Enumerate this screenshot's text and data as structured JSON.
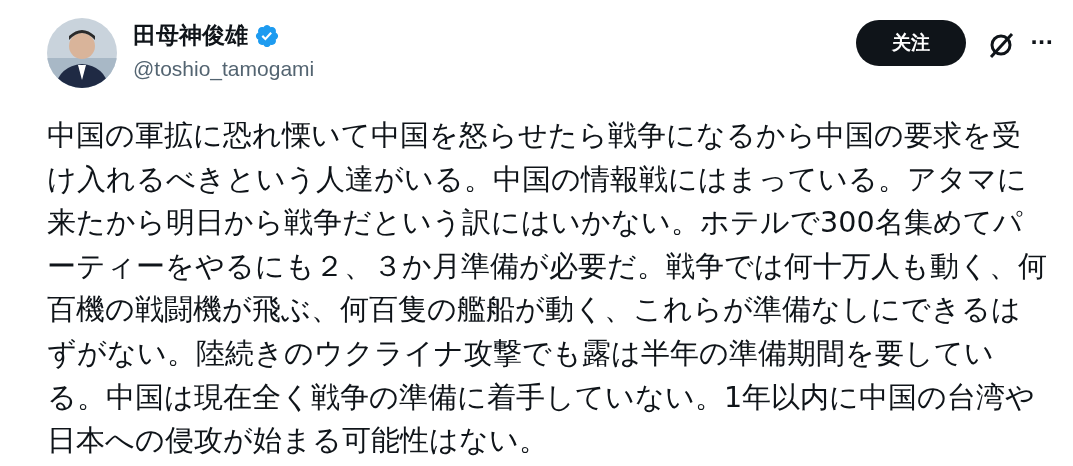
{
  "author": {
    "name": "田母神俊雄",
    "verified": true,
    "handle": "@toshio_tamogami"
  },
  "follow_button": {
    "label": "关注"
  },
  "more_button": {
    "label": "···"
  },
  "post_text": "中国の軍拡に恐れ慄いて中国を怒らせたら戦争になるから中国の要求を受け入れるべきという人達がいる。中国の情報戦にはまっている。アタマに来たから明日から戦争だという訳にはいかない。ホテルで300名集めてパーティーをやるにも２、３か月準備が必要だ。戦争では何十万人も動く、何百機の戦闘機が飛ぶ、何百隻の艦船が動く、これらが準備なしにできるはずがない。陸続きのウクライナ攻撃でも露は半年の準備期間を要している。中国は現在全く戦争の準備に着手していない。1年以内に中国の台湾や日本への侵攻が始まる可能性はない。"
}
